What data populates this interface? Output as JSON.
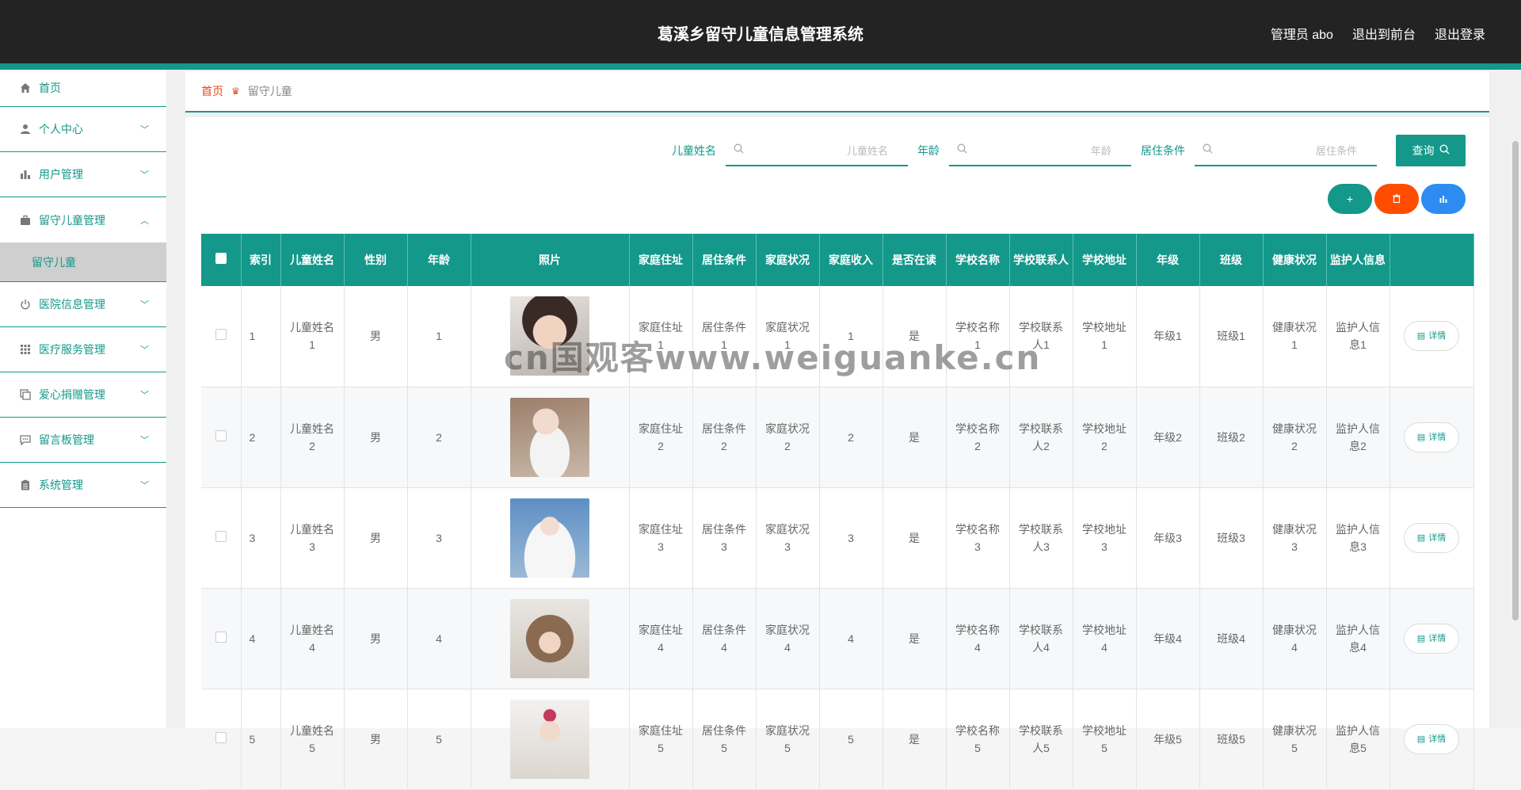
{
  "header": {
    "title": "葛溪乡留守儿童信息管理系统",
    "admin": "管理员 abo",
    "to_front": "退出到前台",
    "logout": "退出登录"
  },
  "sidebar": {
    "items": [
      {
        "label": "首页",
        "icon": "home-icon"
      },
      {
        "label": "个人中心",
        "icon": "user-icon"
      },
      {
        "label": "用户管理",
        "icon": "bar-chart-icon"
      },
      {
        "label": "留守儿童管理",
        "icon": "briefcase-icon"
      },
      {
        "label": "医院信息管理",
        "icon": "power-icon"
      },
      {
        "label": "医疗服务管理",
        "icon": "grid-icon"
      },
      {
        "label": "爱心捐赠管理",
        "icon": "copy-icon"
      },
      {
        "label": "留言板管理",
        "icon": "message-icon"
      },
      {
        "label": "系统管理",
        "icon": "clipboard-icon"
      }
    ],
    "sub_active": "留守儿童"
  },
  "breadcrumb": {
    "home": "首页",
    "current": "留守儿童"
  },
  "search": {
    "name_label": "儿童姓名",
    "name_placeholder": "儿童姓名",
    "age_label": "年龄",
    "age_placeholder": "年龄",
    "living_label": "居住条件",
    "living_placeholder": "居住条件",
    "query_button": "查询"
  },
  "actions": {
    "add": "+",
    "colors": {
      "add": "#13988a",
      "delete": "#ff4d00",
      "stats": "#2e8cf0"
    }
  },
  "table": {
    "headers": [
      "",
      "索引",
      "儿童姓名",
      "性别",
      "年龄",
      "照片",
      "家庭住址",
      "居住条件",
      "家庭状况",
      "家庭收入",
      "是否在读",
      "学校名称",
      "学校联系人",
      "学校地址",
      "年级",
      "班级",
      "健康状况",
      "监护人信息",
      ""
    ],
    "detail_label": "详情",
    "rows": [
      {
        "index": "1",
        "name": "儿童姓名1",
        "gender": "男",
        "age": "1",
        "address": "家庭住址1",
        "living": "居住条件1",
        "family": "家庭状况1",
        "income": "1",
        "studying": "是",
        "school": "学校名称1",
        "contact": "学校联系人1",
        "school_addr": "学校地址1",
        "grade": "年级1",
        "class": "班级1",
        "health": "健康状况1",
        "guardian": "监护人信息1"
      },
      {
        "index": "2",
        "name": "儿童姓名2",
        "gender": "男",
        "age": "2",
        "address": "家庭住址2",
        "living": "居住条件2",
        "family": "家庭状况2",
        "income": "2",
        "studying": "是",
        "school": "学校名称2",
        "contact": "学校联系人2",
        "school_addr": "学校地址2",
        "grade": "年级2",
        "class": "班级2",
        "health": "健康状况2",
        "guardian": "监护人信息2"
      },
      {
        "index": "3",
        "name": "儿童姓名3",
        "gender": "男",
        "age": "3",
        "address": "家庭住址3",
        "living": "居住条件3",
        "family": "家庭状况3",
        "income": "3",
        "studying": "是",
        "school": "学校名称3",
        "contact": "学校联系人3",
        "school_addr": "学校地址3",
        "grade": "年级3",
        "class": "班级3",
        "health": "健康状况3",
        "guardian": "监护人信息3"
      },
      {
        "index": "4",
        "name": "儿童姓名4",
        "gender": "男",
        "age": "4",
        "address": "家庭住址4",
        "living": "居住条件4",
        "family": "家庭状况4",
        "income": "4",
        "studying": "是",
        "school": "学校名称4",
        "contact": "学校联系人4",
        "school_addr": "学校地址4",
        "grade": "年级4",
        "class": "班级4",
        "health": "健康状况4",
        "guardian": "监护人信息4"
      },
      {
        "index": "5",
        "name": "儿童姓名5",
        "gender": "男",
        "age": "5",
        "address": "家庭住址5",
        "living": "居住条件5",
        "family": "家庭状况5",
        "income": "5",
        "studying": "是",
        "school": "学校名称5",
        "contact": "学校联系人5",
        "school_addr": "学校地址5",
        "grade": "年级5",
        "class": "班级5",
        "health": "健康状况5",
        "guardian": "监护人信息5"
      }
    ]
  },
  "watermark": "cn国观客www.weiguanke.cn",
  "colors": {
    "primary": "#13988a",
    "header_bg": "#232323",
    "breadcrumb_home": "#e64a19"
  }
}
